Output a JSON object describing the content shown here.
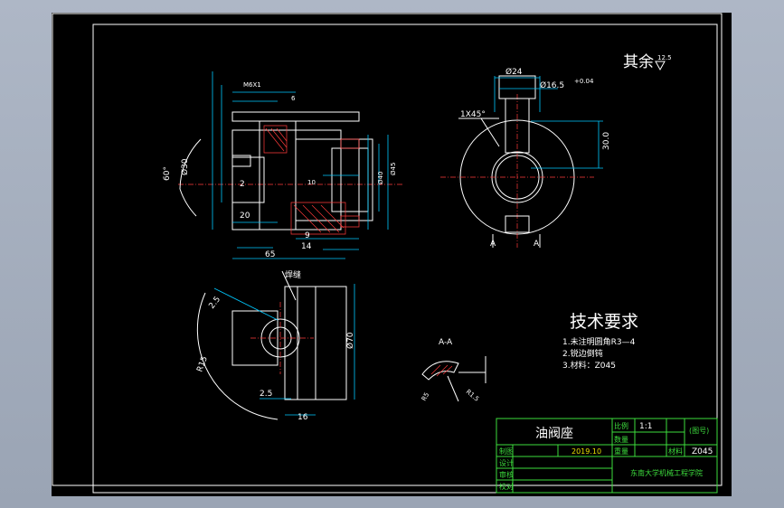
{
  "drawing": {
    "roughness_note": "其余",
    "roughness_value": "12.5",
    "tech_title": "技术要求",
    "tech_items": [
      "1.未注明圆角R3—4",
      "2.锐边倒钝",
      "3.材料：Z045"
    ],
    "section_label": "A-A",
    "weld_label": "焊缝",
    "dims": {
      "d24": "Ø24",
      "d16": "Ø16.5",
      "d16_tol": "+0.04",
      "len30": "30.0",
      "chamfer": "1X45°",
      "cut_a": "A",
      "angle60": "60°",
      "d2": "2",
      "d30": "Ø30",
      "d20": "20",
      "d65": "65",
      "d9": "9",
      "d14": "14",
      "d10": "10",
      "d6": "6",
      "r25a": "2.5",
      "r25b": "2.5",
      "d16b": "16",
      "d70": "Ø70",
      "r15": "R15",
      "rb": "R5",
      "r1": "R1.5",
      "m": "M6X1",
      "d45": "Ø45",
      "d40": "Ø40"
    }
  },
  "title_block": {
    "part_name": "油阀座",
    "ratio_label": "比例",
    "ratio_value": "1:1",
    "drawing_no": "(图号)",
    "date": "2019.10",
    "material_label": "材料",
    "material_value": "Z045",
    "draw_label": "制图",
    "design_label": "设计",
    "review_label": "审核",
    "check_label": "校对",
    "qty_label": "数量",
    "weight_label": "重量",
    "school": "东南大学机械工程学院"
  }
}
